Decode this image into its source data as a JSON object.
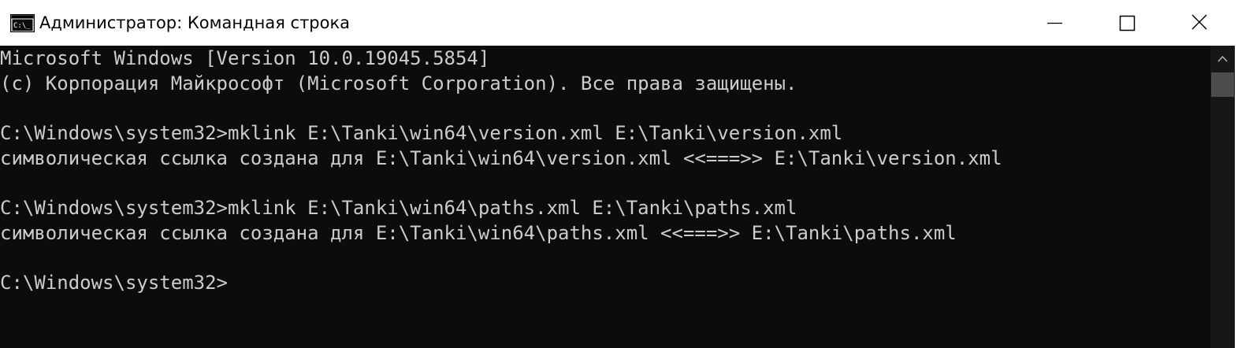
{
  "window": {
    "title": "Администратор: Командная строка",
    "icon": "cmd-icon",
    "controls": [
      "minimize-icon",
      "maximize-icon",
      "close-icon"
    ]
  },
  "console": {
    "lines": [
      "Microsoft Windows [Version 10.0.19045.5854]",
      "(c) Корпорация Майкрософт (Microsoft Corporation). Все права защищены.",
      "",
      "C:\\Windows\\system32>mklink E:\\Tanki\\win64\\version.xml E:\\Tanki\\version.xml",
      "символическая ссылка создана для E:\\Tanki\\win64\\version.xml <<===>> E:\\Tanki\\version.xml",
      "",
      "C:\\Windows\\system32>mklink E:\\Tanki\\win64\\paths.xml E:\\Tanki\\paths.xml",
      "символическая ссылка создана для E:\\Tanki\\win64\\paths.xml <<===>> E:\\Tanki\\paths.xml",
      "",
      "C:\\Windows\\system32>"
    ]
  },
  "colors": {
    "console_background": "#0c0c0c",
    "console_text": "#cccccc",
    "titlebar_background": "#ffffff",
    "scrollbar_track": "#171717",
    "scrollbar_thumb": "#4d4d4d"
  }
}
